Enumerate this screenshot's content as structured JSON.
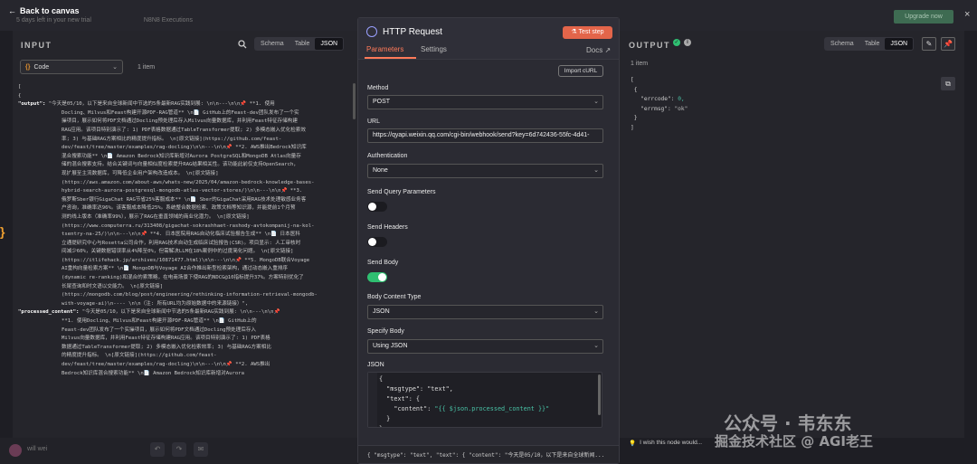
{
  "topbar": {
    "back_label": "Back to canvas",
    "breadcrumb": [
      "5 days left in your new trial",
      "N8N8 Executions"
    ],
    "upgrade_label": "Upgrade now",
    "close": "×"
  },
  "input": {
    "title": "INPUT",
    "view_tabs": [
      "Schema",
      "Table",
      "JSON"
    ],
    "active_view": "JSON",
    "mode_value": "Code",
    "items_count": "1 item",
    "code_lines": [
      {
        "t": "["
      },
      {
        "t": " {"
      },
      {
        "k": "\"output\": ",
        "v": "\"今天是05/10，以下是来自全球新闻中节选的5条最新RAG实践到展: \\n\\n---\\n\\n📌 **1. 使用"
      },
      {
        "v": "Docling、Milvus和Feast构建开源PDF-RAG管道**  \\n📄 GitHub上的Feast-dev团队发布了一个实"
      },
      {
        "v": "操项目，展示如何将PDF文档通过Docling预处理后存入Milvus向量数据库，并利用Feast特征存储构建"
      },
      {
        "v": "RAG应用。该项目特别演示了: 1) PDF表格数据通过TableTransformer提取; 2) 多模态嵌入优化检索效"
      },
      {
        "v": "率; 3) 与基础RAG方案相比的精度提升指标。  \\n[原文链接](https://github.com/feast-"
      },
      {
        "v": "dev/feast/tree/master/examples/rag-docling)\\n\\n---\\n\\n📌 **2. AWS推出Bedrock知识库"
      },
      {
        "v": "混合搜索功能**  \\n📄 Amazon Bedrock知识库新增对Aurora PostgreSQL和MongoDB Atlas向量存"
      },
      {
        "v": "储的混合搜索支持。结合关键词与向量相似度检索提升RAG结果相关性。该功能此前仅支持OpenSearch，"
      },
      {
        "v": "现扩展至主流数据库，可降低企业用户架构改造成本。   \\n[原文链接]"
      },
      {
        "v": "(https://aws.amazon.com/about-aws/whats-new/2025/04/amazon-bedrock-knowledge-bases-"
      },
      {
        "v": "hybrid-search-aurora-postgresql-mongodb-atlas-vector-stores/)\\n\\n---\\n\\n📌 **3."
      },
      {
        "v": "俄罗斯Sber银行GigaChat RAG节省25%客服成本**  \\n📄 Sber的GigaChat采用RAG技术处理敏感业务客"
      },
      {
        "v": "户咨询，准确率达96%。该客服成本降低25%。系统整合数据检索、政策文档等知识源，并能提前1个月预"
      },
      {
        "v": "测的线上版本（准确率99%），展示了RAG在垂直领域的商业化潜力。  \\n[原文链接]"
      },
      {
        "v": "(https://www.computerra.ru/313408/gigachat-sokrashhaet-rashody-avtokompanij-na-kol-"
      },
      {
        "v": "tsentry-na-25/)\\n\\n---\\n\\n📌 **4. 日本医院用RAG自动化临床试验报告生成**  \\n📄 日本医科"
      },
      {
        "v": "立通提研究中心与Rosetta公司合作，利用RAG技术自动生成临床试验报告(CSR)。项目显示: 人工审核时"
      },
      {
        "v": "间减少60%，关键数据错误率从4%降至0%，但需解决LLM在18%案例中的过度简化问题。  \\n[原文链接]"
      },
      {
        "v": "(https://itlifehack.jp/archives/10871477.html)\\n\\n---\\n\\n📌 **5. MongoDB联合Voyage"
      },
      {
        "v": "AI重构向量检索方案**  \\n📄 MongoDB与Voyage AI合作推出新型检索架构，通过动态嵌入重排序"
      },
      {
        "v": "(dynamic re-ranking)和混合的索策略，在电商场景下使RAG的NDCG@10指标提升37%。方案特别优化了"
      },
      {
        "v": "长尾查询和时文语以交能力。  \\n[原文链接]"
      },
      {
        "v": "(https://mongodb.com/blog/post/engineering/rethinking-information-retrieval-mongodb-"
      },
      {
        "v": "with-voyage-ai)\\n---- \\n\\n（注: 所有URL均为原始数据中的来源链接）\","
      },
      {
        "k": "\"processed_content\": ",
        "v": "\"今天是05/10，以下是来自全球新闻中节选的5条最新RAG实践到展: \\n\\n---\\n\\n📌"
      },
      {
        "v": "  **1. 使用Docling、Milvus和Feast构建开源PDF-RAG管道**  \\n📄 GitHub上的"
      },
      {
        "v": "  Feast-dev团队发布了一个实操项目，展示如何将PDF文档通过Docling预处理后存入"
      },
      {
        "v": "  Milvus向量数据库，并利用Feast特征存储构建RAG应用。该项目特别演示了: 1) PDF表格"
      },
      {
        "v": "  数据通过TableTransformer提取; 2) 多模态嵌入优化检索效率; 3) 与基础RAG方案相比"
      },
      {
        "v": "  的精度提升指标。  \\n[原文链接](https://github.com/feast-"
      },
      {
        "v": "  dev/feast/tree/master/examples/rag-docling)\\n\\n---\\n\\n📌 **2. AWS推出"
      },
      {
        "v": "  Bedrock知识库混合搜索功能**  \\n📄 Amazon Bedrock知识库新增对Aurora"
      }
    ]
  },
  "http": {
    "title": "HTTP Request",
    "test_step_label": "Test step",
    "tabs": [
      "Parameters",
      "Settings"
    ],
    "docs_label": "Docs",
    "import_curl_label": "Import cURL",
    "method_label": "Method",
    "method_value": "POST",
    "url_label": "URL",
    "url_value": "https://qyapi.weixin.qq.com/cgi-bin/webhook/send?key=6d742436-55fc-4d41-",
    "auth_label": "Authentication",
    "auth_value": "None",
    "send_query_label": "Send Query Parameters",
    "send_headers_label": "Send Headers",
    "send_body_label": "Send Body",
    "send_query_on": false,
    "send_headers_on": false,
    "send_body_on": true,
    "body_content_type_label": "Body Content Type",
    "body_content_type_value": "JSON",
    "specify_body_label": "Specify Body",
    "specify_body_value": "Using JSON",
    "json_label": "JSON",
    "json_lines": [
      "{",
      "  \"msgtype\": \"text\",",
      "  \"text\": {",
      "    \"content\": ",
      "  }",
      "},"
    ],
    "json_expression": "\"{{ $json.processed_content }}\"",
    "footer_preview": "{  \"msgtype\": \"text\",  \"text\": {     \"content\": \"今天是05/10，以下是来自全球新闻...",
    "accent_color": "#ff7a59"
  },
  "output": {
    "title": "OUTPUT",
    "view_tabs": [
      "Schema",
      "Table",
      "JSON"
    ],
    "active_view": "JSON",
    "items_count": "1 item",
    "json": {
      "errcode_key": "\"errcode\":",
      "errcode_val": "0,",
      "errmsg_key": "\"errmsg\":",
      "errmsg_val": "\"ok\""
    },
    "wish_label": "I wish this node would..."
  },
  "bottom": {
    "user_name": "will wei"
  },
  "watermark": {
    "line1": "公众号 · 韦东东",
    "line2": "掘金技术社区 @ AGI老王"
  }
}
